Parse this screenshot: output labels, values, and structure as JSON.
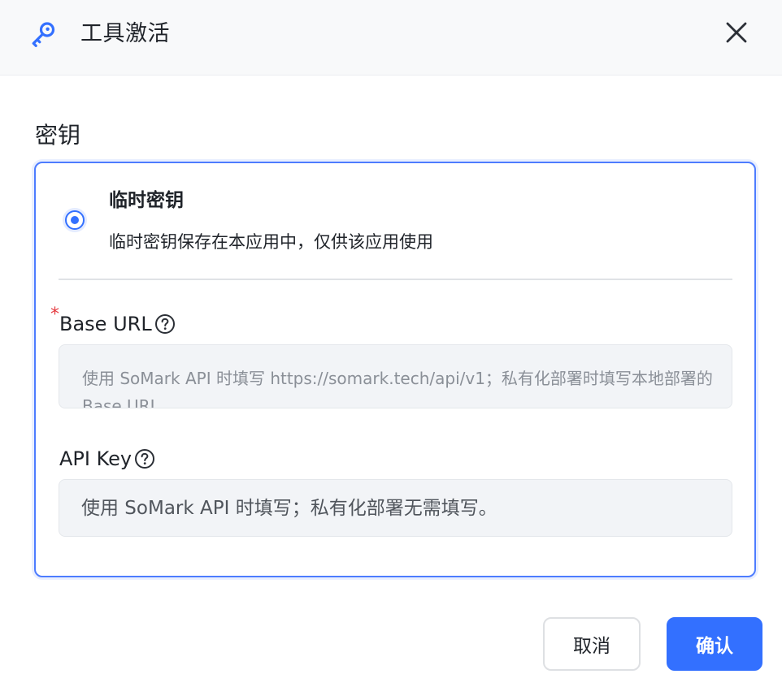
{
  "header": {
    "title": "工具激活",
    "key_icon": "key-icon",
    "close_icon": "close-icon"
  },
  "section": {
    "label": "密钥"
  },
  "option": {
    "title": "临时密钥",
    "description": "临时密钥保存在本应用中，仅供该应用使用",
    "selected": true
  },
  "fields": {
    "base_url": {
      "required_mark": "*",
      "label": "Base URL",
      "placeholder": "使用 SoMark API 时填写 https://somark.tech/api/v1；私有化部署时填写本地部署的 Base URL"
    },
    "api_key": {
      "label": "API Key",
      "placeholder": "使用 SoMark API 时填写；私有化部署无需填写。"
    }
  },
  "footer": {
    "cancel_label": "取消",
    "confirm_label": "确认"
  },
  "colors": {
    "accent": "#3370ff",
    "required": "#e5393f"
  }
}
